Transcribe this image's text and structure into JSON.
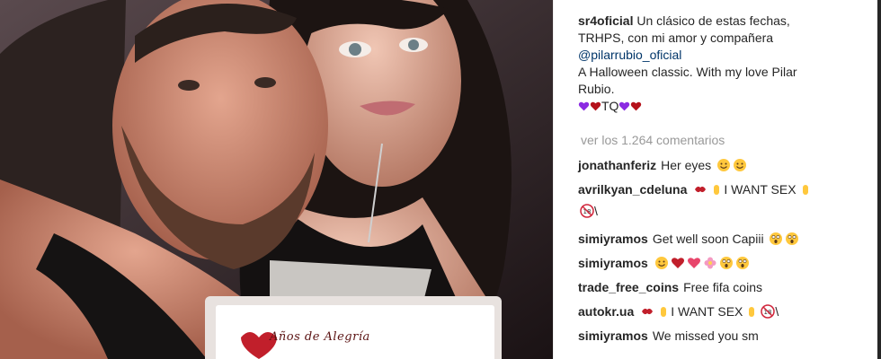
{
  "post": {
    "username": "sr4oficial",
    "caption_line1": "Un clásico de estas fechas,",
    "caption_line2": "TRHPS, con mi amor y compañera",
    "mention": "@pilarrubio_oficial",
    "caption_line4": "A Halloween classic. With my love Pilar",
    "caption_line5": "Rubio.",
    "caption_tail_text": "TQ",
    "view_comments": "ver los 1.264 comentarios"
  },
  "photo": {
    "dvd_text": "Años de Alegría"
  },
  "comments": [
    {
      "user": "jonathanferiz",
      "text": "Her eyes",
      "emojis": [
        "smile-emoji",
        "smile-emoji"
      ]
    },
    {
      "user": "avrilkyan_cdeluna",
      "text": "I WANT SEX",
      "emojis": [
        "kiss-emoji",
        "hand-emoji",
        "hand-emoji",
        "under18-emoji"
      ],
      "line2_text": "\\"
    },
    {
      "user": "simiyramos",
      "text": "Get well soon Capiii",
      "emojis": [
        "surprised-emoji",
        "surprised-emoji"
      ]
    },
    {
      "user": "simiyramos",
      "text": "",
      "emojis": [
        "smile-emoji",
        "hearts-emoji",
        "hearts-emoji",
        "flower-emoji",
        "surprised-emoji",
        "surprised-emoji"
      ]
    },
    {
      "user": "trade_free_coins",
      "text": "Free fifa coins",
      "emojis": []
    },
    {
      "user": "autokr.ua",
      "text": "I WANT SEX",
      "emojis": [
        "kiss-emoji",
        "hand-emoji",
        "hand-emoji",
        "under18-emoji"
      ],
      "tail": "\\"
    },
    {
      "user": "simiyramos",
      "text": "We missed you sm",
      "emojis": []
    }
  ],
  "colors": {
    "text": "#262626",
    "muted": "#999999",
    "mention": "#003569",
    "heart_red": "#b5121b",
    "heart_purple": "#8b2be2",
    "emoji_yellow": "#ffc83d"
  }
}
